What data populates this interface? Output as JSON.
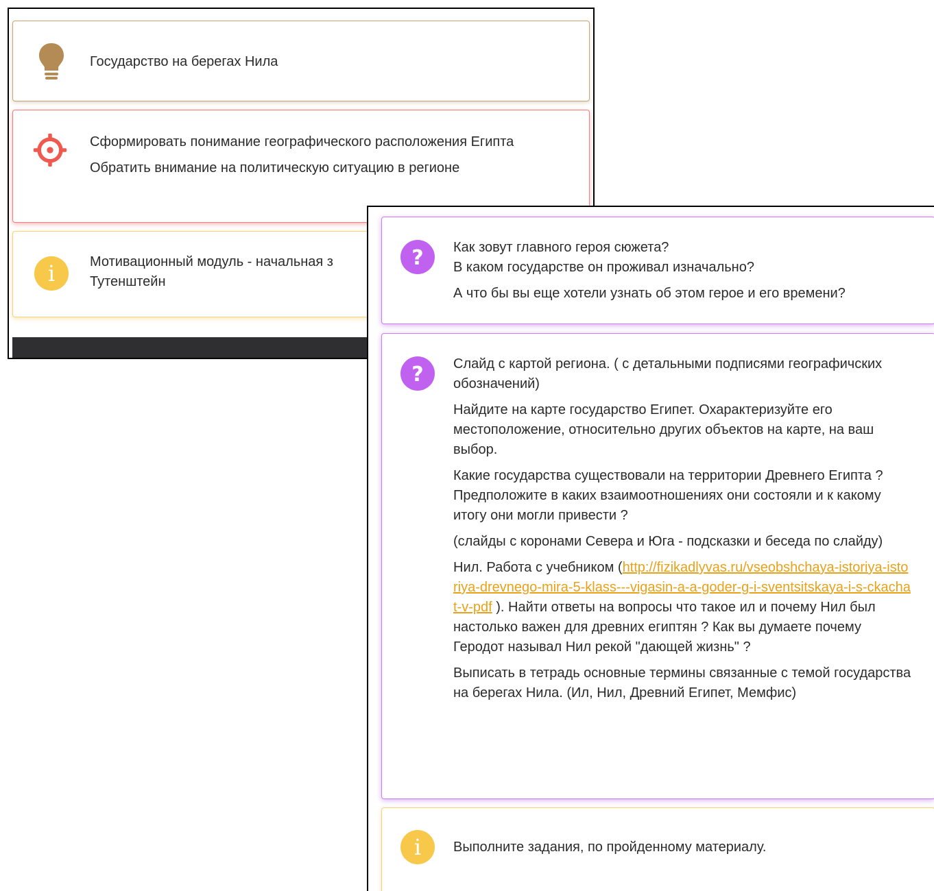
{
  "back_panel": {
    "topic": {
      "icon": "lightbulb-icon",
      "text": "Государство на берегах Нила",
      "color": "#b58b55"
    },
    "goals": {
      "icon": "crosshair-target-icon",
      "color": "#ee5a4f",
      "lines": [
        "Сформировать понимание географического расположения Египта",
        "Обратить внимание на политическую ситуацию в регионе"
      ]
    },
    "motivation": {
      "icon": "info-icon",
      "color": "#f7c84a",
      "text": "Мотивационный модуль - начальная з Тутенштейн"
    }
  },
  "front_panel": {
    "questions": {
      "icon": "question-icon",
      "color": "#c061f0",
      "lines": [
        "Как зовут главного героя сюжета?",
        "В каком государстве он проживал изначально?",
        "А что бы вы еще хотели узнать об этом герое и его времени?"
      ]
    },
    "tasks": {
      "icon": "question-icon",
      "color": "#c061f0",
      "p1": "Слайд с картой региона. ( с детальными подписями географичских обозначений)",
      "p2": "Найдите на карте государство Египет. Охарактеризуйте его местоположение, относительно других объектов на карте, на ваш выбор.",
      "p3": "Какие государства существовали на территории Древнего Египта ? Предположите в каких взаимоотношениях они состояли и к какому итогу они могли привести ?",
      "p4": "(слайды с коронами Севера и Юга - подсказки и беседа по слайду)",
      "p5_before": "Нил. Работа с учебником (",
      "p5_link": "http://fizikadlyvas.ru/vseobshchaya-istoriya-istoriya-drevnego-mira-5-klass---vigasin-a-a-goder-g-i-sventsitskaya-i-s-ckachat-v-pdf",
      "p5_after": " ). Найти ответы на вопросы что такое ил и почему Нил был настолько важен для древних египтян ? Как вы думаете почему Геродот  называл Нил рекой \"дающей жизнь\" ?",
      "p6": "Выписать в тетрадь основные термины связанные с темой государства на берегах Нила. (Ил, Нил, Древний Египет, Мемфис)"
    },
    "homework": {
      "icon": "info-icon",
      "color": "#f7c84a",
      "text": "Выполните задания, по пройденному материалу."
    }
  }
}
